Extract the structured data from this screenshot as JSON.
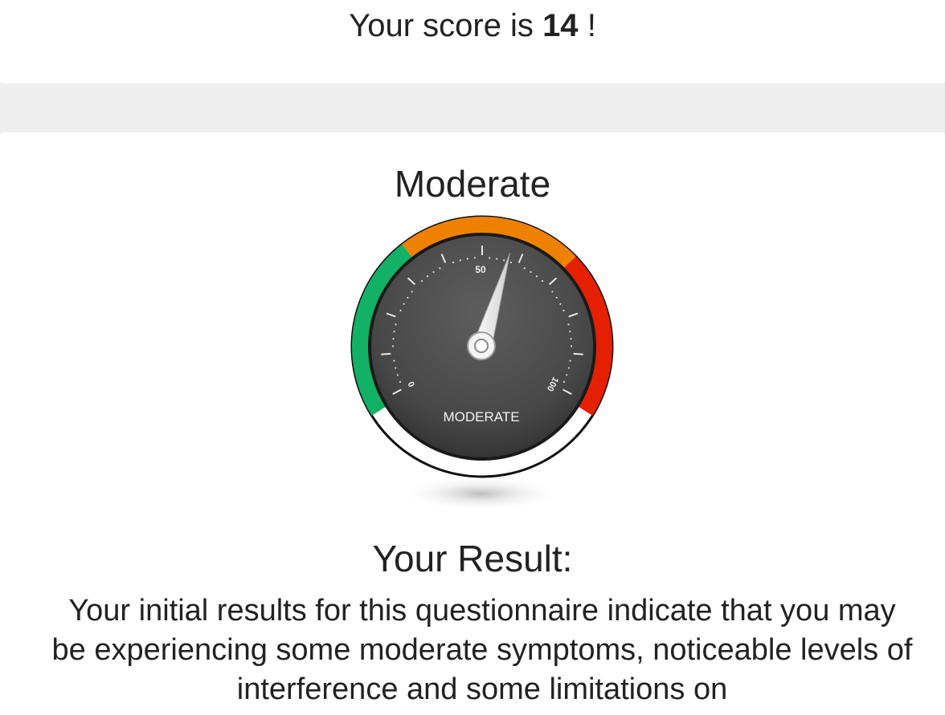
{
  "score": {
    "prefix": "Your score is",
    "value": "14",
    "suffix": "!"
  },
  "result": {
    "level_title": "Moderate",
    "heading": "Your Result:",
    "description": "Your initial results for this questionnaire indicate that you may be experiencing some moderate symptoms, noticeable levels of interference and some limitations on"
  },
  "gauge": {
    "label": "MODERATE",
    "tick_min": "0",
    "tick_mid": "50",
    "tick_max": "100",
    "scale_min": 0,
    "scale_max": 100,
    "needle_value": 57,
    "colors": {
      "low": "#13b165",
      "mid": "#ee8200",
      "high": "#e52000",
      "dial": "#4a4a4a"
    }
  }
}
